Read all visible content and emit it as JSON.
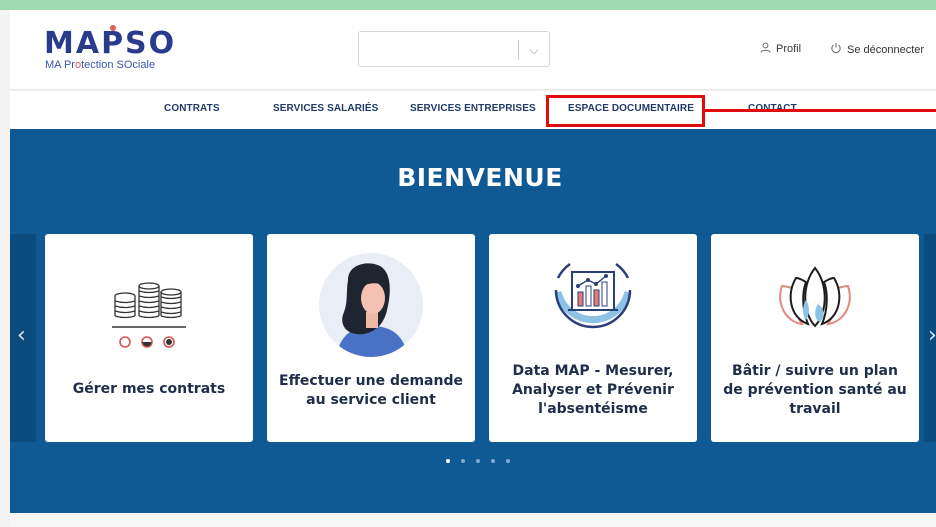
{
  "header": {
    "logo_text": "MAPSO",
    "logo_sub_blue": "MA Pr",
    "logo_sub_red": "o",
    "logo_sub_rest": "tection SOciale",
    "profile_label": "Profil",
    "logout_label": "Se déconnecter",
    "select_value": ""
  },
  "nav": {
    "items": [
      "CONTRATS",
      "SERVICES SALARIÉS",
      "SERVICES ENTREPRISES",
      "ESPACE DOCUMENTAIRE",
      "CONTACT"
    ]
  },
  "hero": {
    "title": "BIENVENUE",
    "cards": [
      {
        "label": "Gérer mes contrats",
        "icon": "coins-stack-icon"
      },
      {
        "label": "Effectuer une demande au service client",
        "icon": "customer-avatar-icon"
      },
      {
        "label": "Data MAP - Mesurer, Analyser et Prévenir l'absentéisme",
        "icon": "analytics-chart-icon"
      },
      {
        "label": "Bâtir / suivre un plan de prévention santé au travail",
        "icon": "lotus-icon"
      }
    ],
    "carousel_active": 1,
    "carousel_total": 5
  },
  "colors": {
    "hero_bg": "#0f5a94",
    "nav_text": "#1f3a66",
    "highlight": "#e10b0b",
    "logo": "#2a3a8c"
  }
}
